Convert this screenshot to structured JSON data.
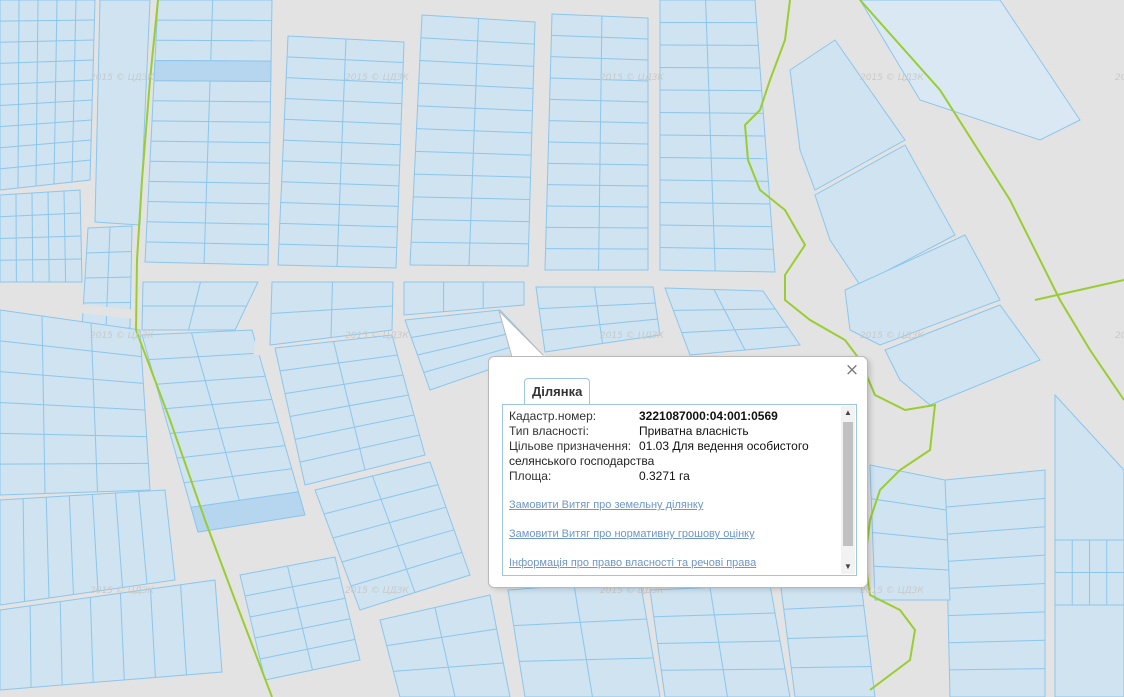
{
  "map": {
    "watermark": "2015 © ЦДЗК",
    "colors": {
      "background": "#e3e3e3",
      "parcel_fill": "#cfe3f1",
      "parcel_dark_fill": "#b5d6ee",
      "parcel_stroke": "#8cc6ec",
      "boundary_line": "#9acd32"
    }
  },
  "popup": {
    "tab_title": "Ділянка",
    "close_label": "×",
    "fields": [
      {
        "label": "Кадастр.номер:",
        "value": "3221087000:04:001:0569",
        "bold": true
      },
      {
        "label": "Тип власності:",
        "value": "Приватна власність",
        "bold": false
      },
      {
        "label": "Цільове призначення:",
        "value": "01.03 Для ведення особистого",
        "bold": false
      }
    ],
    "purpose_continuation": "селянського господарства",
    "area_label": "Площа:",
    "area_value": "0.3271 га",
    "links": [
      "Замовити Витяг про земельну ділянку",
      "Замовити Витяг про нормативну грошову оцінку",
      "Інформація про право власності та речові права"
    ],
    "scroll_up_icon": "▲",
    "scroll_down_icon": "▼"
  }
}
